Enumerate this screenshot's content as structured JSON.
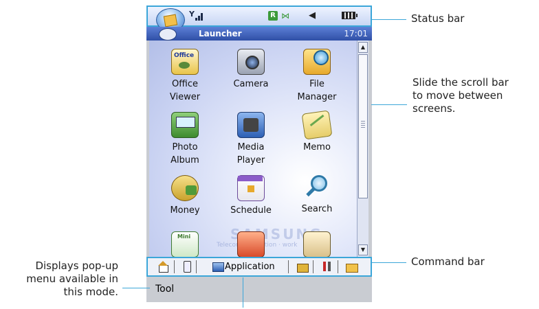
{
  "status_bar": {
    "icons": [
      "phone-orb-icon",
      "signal-icon",
      "roaming-r-icon",
      "bluetooth-icon",
      "speaker-icon",
      "battery-icon"
    ],
    "r_badge": "R",
    "bt_glyph": "⋈",
    "speaker_glyph": "◀"
  },
  "title_bar": {
    "title": "Launcher",
    "time": "17:01"
  },
  "apps": [
    {
      "label": "Office\nViewer",
      "icon": "office-viewer-icon"
    },
    {
      "label": "Camera",
      "icon": "camera-icon"
    },
    {
      "label": "File\nManager",
      "icon": "file-manager-icon"
    },
    {
      "label": "Photo\nAlbum",
      "icon": "photo-album-icon"
    },
    {
      "label": "Media\nPlayer",
      "icon": "media-player-icon"
    },
    {
      "label": "Memo",
      "icon": "memo-icon"
    },
    {
      "label": "Money",
      "icon": "money-icon"
    },
    {
      "label": "Schedule",
      "icon": "schedule-icon"
    },
    {
      "label": "Search",
      "icon": "search-icon"
    }
  ],
  "watermark": {
    "brand": "SAMSUNG",
    "sub": "Telecommunication · work"
  },
  "command_bar": {
    "application_label": "Application"
  },
  "tool_bar": {
    "label": "Tool"
  },
  "callouts": {
    "status_bar": "Status bar",
    "scroll": "Slide the scroll bar\nto move between\nscreens.",
    "command_bar": "Command bar",
    "popup_menu": "Displays pop-up\nmenu available in\nthis mode."
  },
  "colors": {
    "accent_line": "#3ba6d9",
    "title_bar": "#2f4fa6"
  }
}
